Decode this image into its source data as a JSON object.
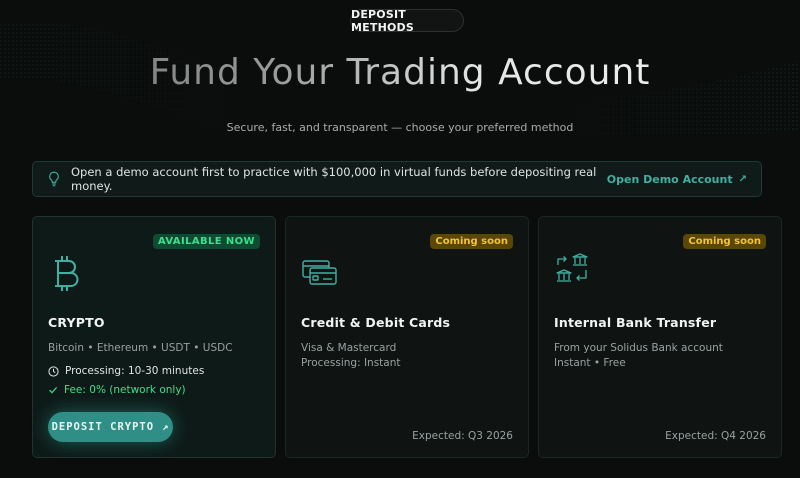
{
  "header": {
    "pill": "DEPOSIT METHODS",
    "title": "Fund Your Trading Account",
    "subtitle": "Secure, fast, and transparent — choose your preferred method"
  },
  "banner": {
    "icon": "lightbulb-icon",
    "message": "Open a demo account first to practice with $100,000 in virtual funds before depositing real money.",
    "link_label": "Open Demo Account",
    "link_arrow": "↗"
  },
  "cards": [
    {
      "icon": "bitcoin-icon",
      "badge": "AVAILABLE NOW",
      "title": "CRYPTO",
      "description": "Bitcoin • Ethereum • USDT • USDC",
      "processing": "Processing: 10-30 minutes",
      "fee": "Fee: 0% (network only)",
      "button_label": "DEPOSIT CRYPTO",
      "button_arrow": "↗"
    },
    {
      "icon": "credit-cards-icon",
      "badge": "Coming soon",
      "title": "Credit & Debit Cards",
      "description_line1": "Visa & Mastercard",
      "description_line2": "Processing: Instant",
      "expected": "Expected: Q3 2026"
    },
    {
      "icon": "bank-transfer-icon",
      "badge": "Coming soon",
      "title": "Internal Bank Transfer",
      "description_line1": "From your Solidus Bank account",
      "description_line2": "Instant • Free",
      "expected": "Expected: Q4 2026"
    }
  ],
  "colors": {
    "accent": "#3fb0a1",
    "available_text": "#3be08a",
    "coming_soon_text": "#f2c433",
    "background": "#0b0c0c"
  }
}
